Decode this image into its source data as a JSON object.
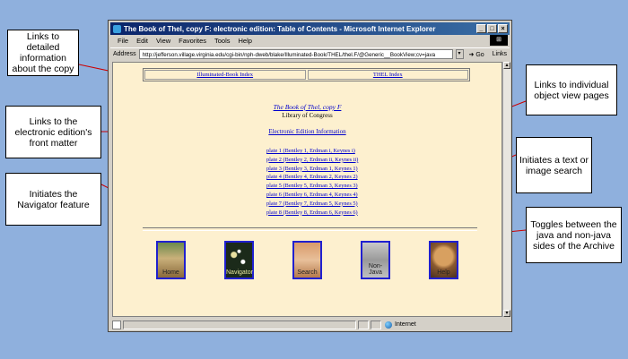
{
  "callouts": [
    "Links to detailed information about the copy",
    "Links to the electronic  edition's front matter",
    "Initiates the Navigator feature",
    "Links to individual object view pages",
    "Initiates a text or image search",
    "Toggles between the java and non-java sides of the Archive"
  ],
  "window": {
    "title": "The Book of Thel, copy F: electronic edition: Table of Contents - Microsoft Internet Explorer",
    "menu": [
      "File",
      "Edit",
      "View",
      "Favorites",
      "Tools",
      "Help"
    ],
    "address_label": "Address",
    "address": "http://jefferson.village.virginia.edu/cgi-bin/nph-dweb/blake/Illuminated-Book/THEL/thel.F/@Generic__BookView;cv=java",
    "go": "Go",
    "links": "Links",
    "status_zone": "Internet"
  },
  "page": {
    "index_links": [
      "Illuminated-Book Index",
      "THEL Index"
    ],
    "book_title": "The Book of Thel, copy F",
    "library": "Library of Congress",
    "edition_info": "Electronic Edition Information",
    "plates": [
      "plate 1 (Bentley 1, Erdman i, Keynes i)",
      "plate 2 (Bentley 2, Erdman ii, Keynes ii)",
      "plate 3 (Bentley 3, Erdman 1, Keynes 1)",
      "plate 4 (Bentley 4, Erdman 2, Keynes 2)",
      "plate 5 (Bentley 5, Erdman 3, Keynes 3)",
      "plate 6 (Bentley 6, Erdman 4, Keynes 4)",
      "plate 7 (Bentley 7, Erdman 5, Keynes 5)",
      "plate 8 (Bentley 8, Erdman 6, Keynes 6)"
    ],
    "nav_buttons": [
      "Home",
      "Navigator",
      "Search",
      "Non-Java",
      "Help"
    ]
  },
  "colors": {
    "background": "#8fb0dd",
    "page": "#fdf0cf",
    "link": "#0000cc",
    "arrow": "#cc0000"
  }
}
